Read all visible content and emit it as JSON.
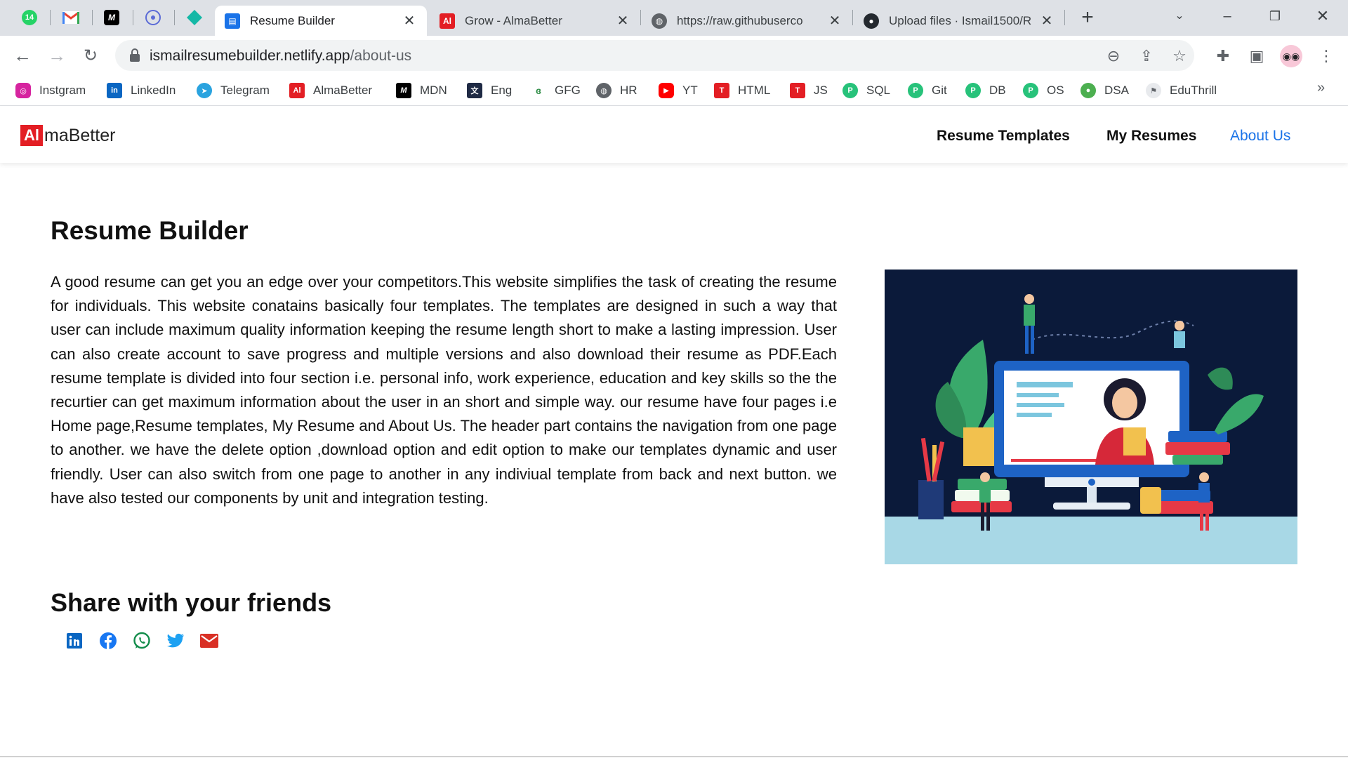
{
  "browser": {
    "pinned_tabs": [
      {
        "name": "whatsapp",
        "badge": "14"
      },
      {
        "name": "gmail"
      },
      {
        "name": "mdn"
      },
      {
        "name": "react"
      },
      {
        "name": "diamond-app"
      }
    ],
    "tabs": [
      {
        "title": "Resume Builder",
        "active": true
      },
      {
        "title": "Grow - AlmaBetter",
        "active": false
      },
      {
        "title": "https://raw.githubuserco",
        "active": false
      },
      {
        "title": "Upload files · Ismail1500/R",
        "active": false
      }
    ],
    "address": {
      "host": "ismailresumebuilder.netlify.app",
      "path": "/about-us"
    },
    "bookmarks": [
      "Instgram",
      "LinkedIn",
      "Telegram",
      "AlmaBetter",
      "MDN",
      "Eng",
      "GFG",
      "HR",
      "YT",
      "HTML",
      "JS",
      "SQL",
      "Git",
      "DB",
      "OS",
      "DSA",
      "EduThrill"
    ]
  },
  "site": {
    "logo_mark": "Al",
    "logo_text": "maBetter",
    "nav": {
      "templates": "Resume Templates",
      "my_resumes": "My Resumes",
      "about": "About Us"
    }
  },
  "main": {
    "title": "Resume Builder",
    "body": "A good resume can get you an edge over your competitors.This website simplifies the task of creating the resume for individuals. This website conatains basically four templates. The templates are designed in such a way that user can include maximum quality information keeping the resume length short to make a lasting impression. User can also create account to save progress and multiple versions and also download their resume as PDF.Each resume template is divided into four section i.e. personal info, work experience, education and key skills so the the recurtier can get maximum information about the user in an short and simple way. our resume have four pages i.e Home page,Resume templates, My Resume and About Us. The header part contains the navigation from one page to another. we have the delete option ,download option and edit option to make our templates dynamic and user friendly. User can also switch from one page to another in any indiviual template from back and next button. we have also tested our components by unit and integration testing.",
    "share_title": "Share with your friends"
  },
  "colors": {
    "accent": "#1a73e8",
    "brand_red": "#e31e24",
    "hero_bg": "#0b1a3a"
  }
}
